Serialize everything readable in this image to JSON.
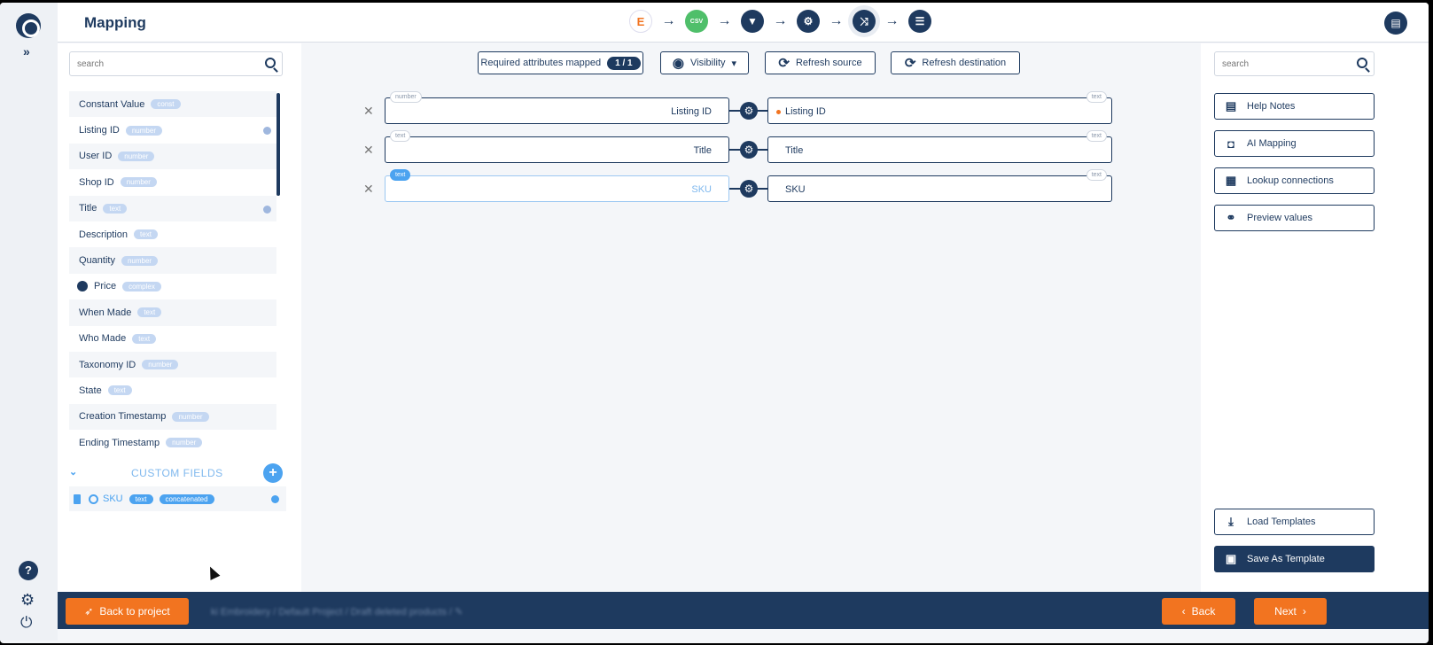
{
  "header": {
    "title": "Mapping",
    "steps": [
      {
        "name": "etsy-source",
        "glyph": "E"
      },
      {
        "name": "csv",
        "glyph": "CSV"
      },
      {
        "name": "filter",
        "glyph": "▼"
      },
      {
        "name": "settings",
        "glyph": "⚙"
      },
      {
        "name": "mapping",
        "glyph": "⤨"
      },
      {
        "name": "adjustments",
        "glyph": "☰"
      }
    ],
    "arrow_glyph": "→"
  },
  "rail": {
    "expand": "»",
    "help": "?",
    "gear": "⚙",
    "power": "⏻"
  },
  "left": {
    "search_placeholder": "search",
    "attributes": [
      {
        "label": "Constant Value",
        "type": "const"
      },
      {
        "label": "Listing ID",
        "type": "number"
      },
      {
        "label": "User ID",
        "type": "number"
      },
      {
        "label": "Shop ID",
        "type": "number"
      },
      {
        "label": "Title",
        "type": "text"
      },
      {
        "label": "Description",
        "type": "text"
      },
      {
        "label": "Quantity",
        "type": "number"
      },
      {
        "label": "Price",
        "type": "complex"
      },
      {
        "label": "When Made",
        "type": "text"
      },
      {
        "label": "Who Made",
        "type": "text"
      },
      {
        "label": "Taxonomy ID",
        "type": "number"
      },
      {
        "label": "State",
        "type": "text"
      },
      {
        "label": "Creation Timestamp",
        "type": "number"
      },
      {
        "label": "Ending Timestamp",
        "type": "number"
      }
    ],
    "custom_fields_label": "CUSTOM FIELDS",
    "custom_add": "+",
    "custom_fields": [
      {
        "label": "SKU",
        "type": "text",
        "kind": "concatenated"
      }
    ]
  },
  "toolbar": {
    "required_label": "Required attributes mapped",
    "required_count": "1 / 1",
    "visibility": "Visibility",
    "refresh_source": "Refresh source",
    "refresh_destination": "Refresh destination"
  },
  "mappings": [
    {
      "source": "Listing ID",
      "source_type": "number",
      "dest": "Listing ID",
      "dest_type": "text",
      "required": true
    },
    {
      "source": "Title",
      "source_type": "text",
      "dest": "Title",
      "dest_type": "text",
      "required": false
    },
    {
      "source": "SKU",
      "source_type": "text",
      "dest": "SKU",
      "dest_type": "text",
      "required": false
    }
  ],
  "right": {
    "search_placeholder": "search",
    "help_notes": "Help Notes",
    "ai_mapping": "AI Mapping",
    "lookup_connections": "Lookup connections",
    "preview_values": "Preview values",
    "load_templates": "Load Templates",
    "save_as_template": "Save As Template"
  },
  "footer": {
    "back_to_project": "Back to project",
    "breadcrumb": "ki Embroidery / Default Project / Draft deleted products / ✎",
    "back": "Back",
    "next": "Next"
  },
  "colors": {
    "primary": "#1e3a5f",
    "accent": "#f27420",
    "light_blue": "#4ca3f0",
    "pill": "#c4d7f2"
  }
}
